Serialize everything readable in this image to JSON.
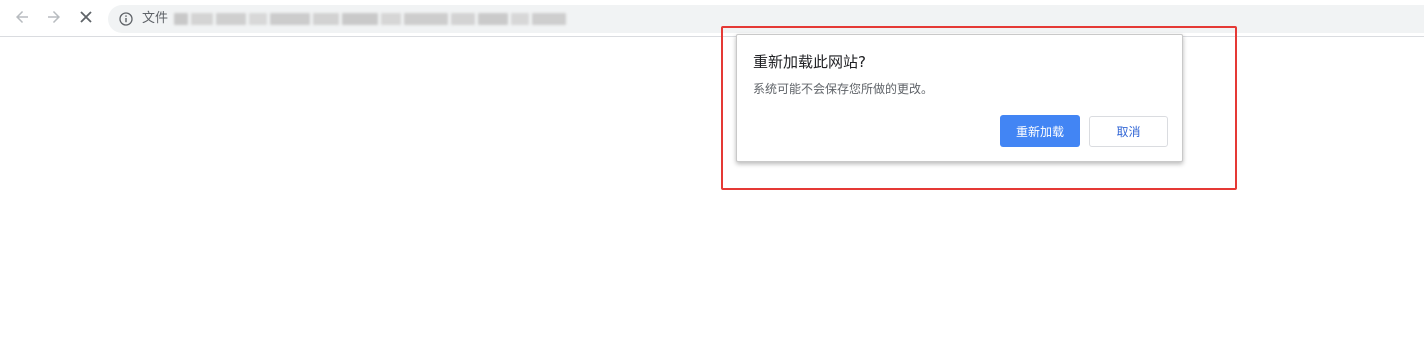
{
  "toolbar": {
    "back_icon": "arrow-left-icon",
    "forward_icon": "arrow-right-icon",
    "stop_icon": "close-icon",
    "omnibox": {
      "security_icon": "info-icon",
      "scheme_label": "文件"
    }
  },
  "dialog": {
    "title": "重新加载此网站?",
    "message": "系统可能不会保存您所做的更改。",
    "confirm_label": "重新加载",
    "cancel_label": "取消"
  },
  "colors": {
    "accent": "#4285f4",
    "highlight_border": "#e53935",
    "link_text": "#3367d6"
  }
}
